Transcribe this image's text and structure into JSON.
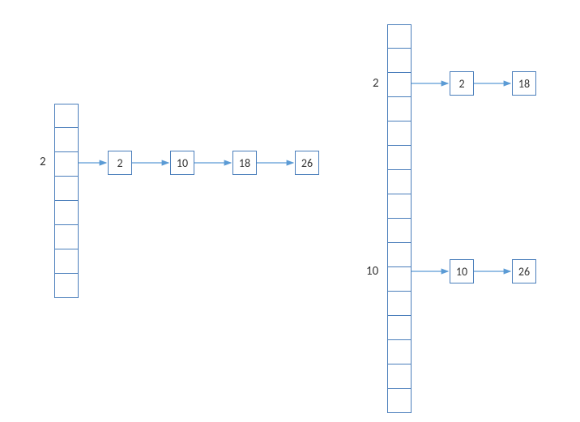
{
  "leftTable": {
    "size": 8,
    "rows": [
      {
        "index": 2,
        "label": "2",
        "chain": [
          "2",
          "10",
          "18",
          "26"
        ]
      }
    ]
  },
  "rightTable": {
    "size": 16,
    "rows": [
      {
        "index": 2,
        "label": "2",
        "chain": [
          "2",
          "18"
        ]
      },
      {
        "index": 10,
        "label": "10",
        "chain": [
          "10",
          "26"
        ]
      }
    ]
  }
}
